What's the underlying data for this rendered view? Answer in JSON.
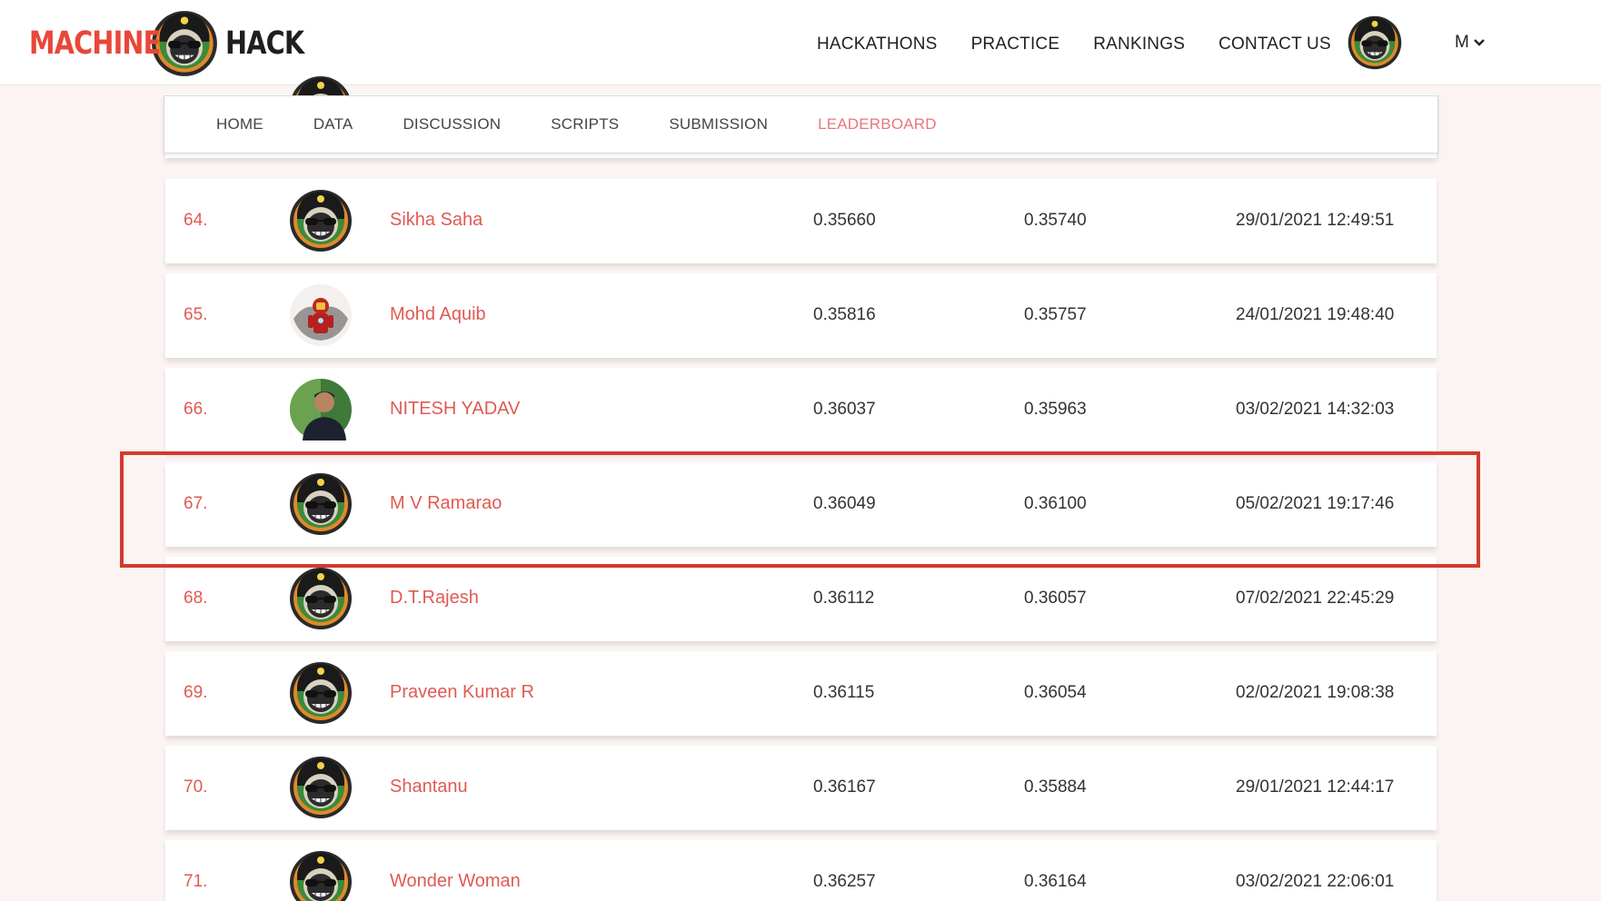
{
  "brand": {
    "left_word": "MACHINE",
    "right_word": "HACK",
    "mascot_icon": "monkey-astronaut-icon",
    "accent_color": "#e8473a"
  },
  "nav": {
    "items": [
      "HACKATHONS",
      "PRACTICE",
      "RANKINGS",
      "CONTACT US"
    ],
    "user_initial": "M"
  },
  "tabs": {
    "items": [
      "HOME",
      "DATA",
      "DISCUSSION",
      "SCRIPTS",
      "SUBMISSION",
      "LEADERBOARD"
    ],
    "active": "LEADERBOARD",
    "active_color": "#e8777a"
  },
  "leaderboard": {
    "rows": [
      {
        "rank": "64.",
        "name": "Sikha Saha",
        "public_score": "0.35660",
        "private_score": "0.35740",
        "submitted": "29/01/2021 12:49:51",
        "avatar": "monkey-astronaut-icon"
      },
      {
        "rank": "65.",
        "name": "Mohd Aquib",
        "public_score": "0.35816",
        "private_score": "0.35757",
        "submitted": "24/01/2021 19:48:40",
        "avatar": "ironman-avatar"
      },
      {
        "rank": "66.",
        "name": "NITESH YADAV",
        "public_score": "0.36037",
        "private_score": "0.35963",
        "submitted": "03/02/2021 14:32:03",
        "avatar": "user-photo-avatar"
      },
      {
        "rank": "67.",
        "name": "M V Ramarao",
        "public_score": "0.36049",
        "private_score": "0.36100",
        "submitted": "05/02/2021 19:17:46",
        "avatar": "monkey-astronaut-icon"
      },
      {
        "rank": "68.",
        "name": "D.T.Rajesh",
        "public_score": "0.36112",
        "private_score": "0.36057",
        "submitted": "07/02/2021 22:45:29",
        "avatar": "monkey-astronaut-icon"
      },
      {
        "rank": "69.",
        "name": "Praveen Kumar R",
        "public_score": "0.36115",
        "private_score": "0.36054",
        "submitted": "02/02/2021 19:08:38",
        "avatar": "monkey-astronaut-icon"
      },
      {
        "rank": "70.",
        "name": "Shantanu",
        "public_score": "0.36167",
        "private_score": "0.35884",
        "submitted": "29/01/2021 12:44:17",
        "avatar": "monkey-astronaut-icon"
      },
      {
        "rank": "71.",
        "name": "Wonder Woman",
        "public_score": "0.36257",
        "private_score": "0.36164",
        "submitted": "03/02/2021 22:06:01",
        "avatar": "monkey-astronaut-icon"
      }
    ],
    "highlighted_rank": "67.",
    "highlight_color": "#d43a2f",
    "rank_color": "#e05a52"
  }
}
